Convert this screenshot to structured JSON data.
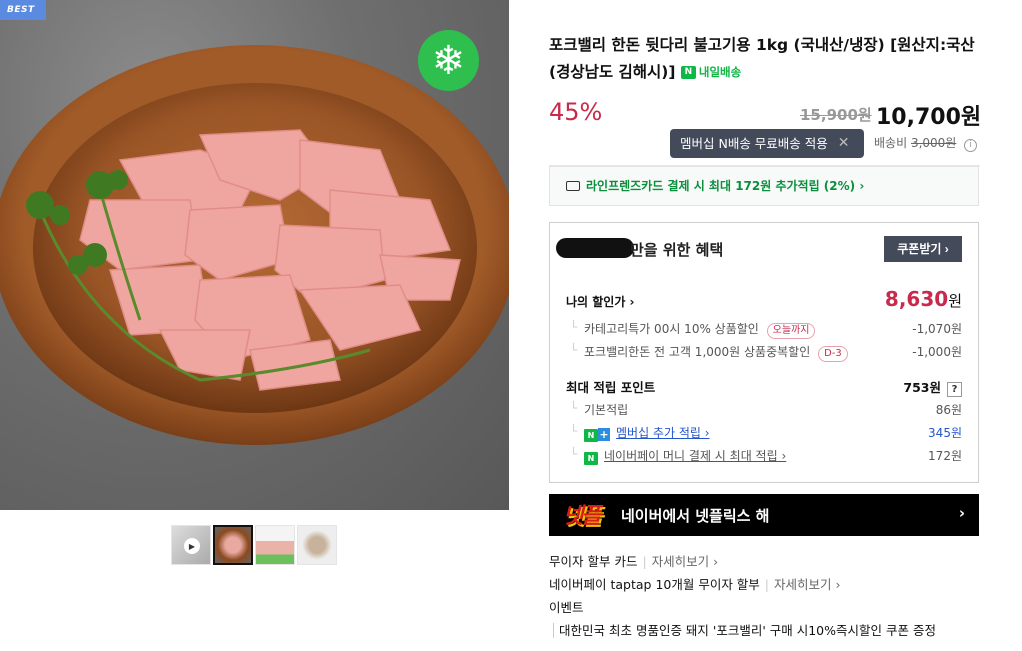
{
  "gallery": {
    "best_badge": "BEST",
    "freeze_icon": "snowflake-icon",
    "thumbnails": [
      {
        "name": "video-thumbnail",
        "icon": "play-icon"
      },
      {
        "name": "plate-thumbnail",
        "active": true
      },
      {
        "name": "package-thumbnail"
      },
      {
        "name": "bowl-thumbnail"
      }
    ]
  },
  "product": {
    "title": "포크밸리 한돈 뒷다리 불고기용 1kg (국내산/냉장) [원산지:국산(경상남도 김해시)]",
    "delivery_label": "내일배송",
    "delivery_icon_text": "N",
    "discount": "45%",
    "original_price": "15,900원",
    "sale_price": "10,700원"
  },
  "tooltip": {
    "text": "멤버십 N배송 무료배송 적용",
    "close": "✕"
  },
  "shipping": {
    "label": "배송비",
    "fee": "3,000원",
    "info": "i"
  },
  "card_promo": {
    "text": "라인프렌즈카드 결제 시 최대 172원 추가적립 (2%) ›"
  },
  "benefit": {
    "heading": "만을 위한 혜택",
    "coupon_button": "쿠폰받기 ›",
    "my_price_label": "나의 할인가 ›",
    "my_price_value": "8,630",
    "my_price_unit": "원",
    "discounts": [
      {
        "label": "카테고리특가 00시 10% 상품할인",
        "pill": "오늘까지",
        "amount": "-1,070원"
      },
      {
        "label": "포크밸리한돈 전 고객 1,000원 상품중복할인",
        "pill": "D-3",
        "amount": "-1,000원"
      }
    ],
    "points_label": "최대 적립 포인트",
    "points_value": "753원",
    "points_help": "?",
    "points": [
      {
        "label": "기본적립",
        "amount": "86원"
      },
      {
        "label": "멤버십 추가 적립 ›",
        "amount": "345원",
        "badge_n": "N",
        "badge_plus": "+"
      },
      {
        "label": "네이버페이 머니 결제 시 최대 적립 ›",
        "amount": "172원",
        "badge_n": "N"
      }
    ]
  },
  "netflix_banner": {
    "logo": "넷플",
    "text": "네이버에서 넷플릭스 해",
    "arrow": "›"
  },
  "extra": {
    "installment_label": "무이자 할부 카드",
    "installment_more": "자세히보기 ›",
    "taptap_label": "네이버페이 taptap 10개월 무이자 할부",
    "taptap_more": "자세히보기 ›",
    "event_label": "이벤트",
    "event_desc": "대한민국 최초 명품인증 돼지 '포크밸리' 구매 시10%즉시할인 쿠폰 증정"
  },
  "colors": {
    "discount_red": "#c9294b",
    "naver_green": "#10b646",
    "dark_button": "#434a5a"
  }
}
